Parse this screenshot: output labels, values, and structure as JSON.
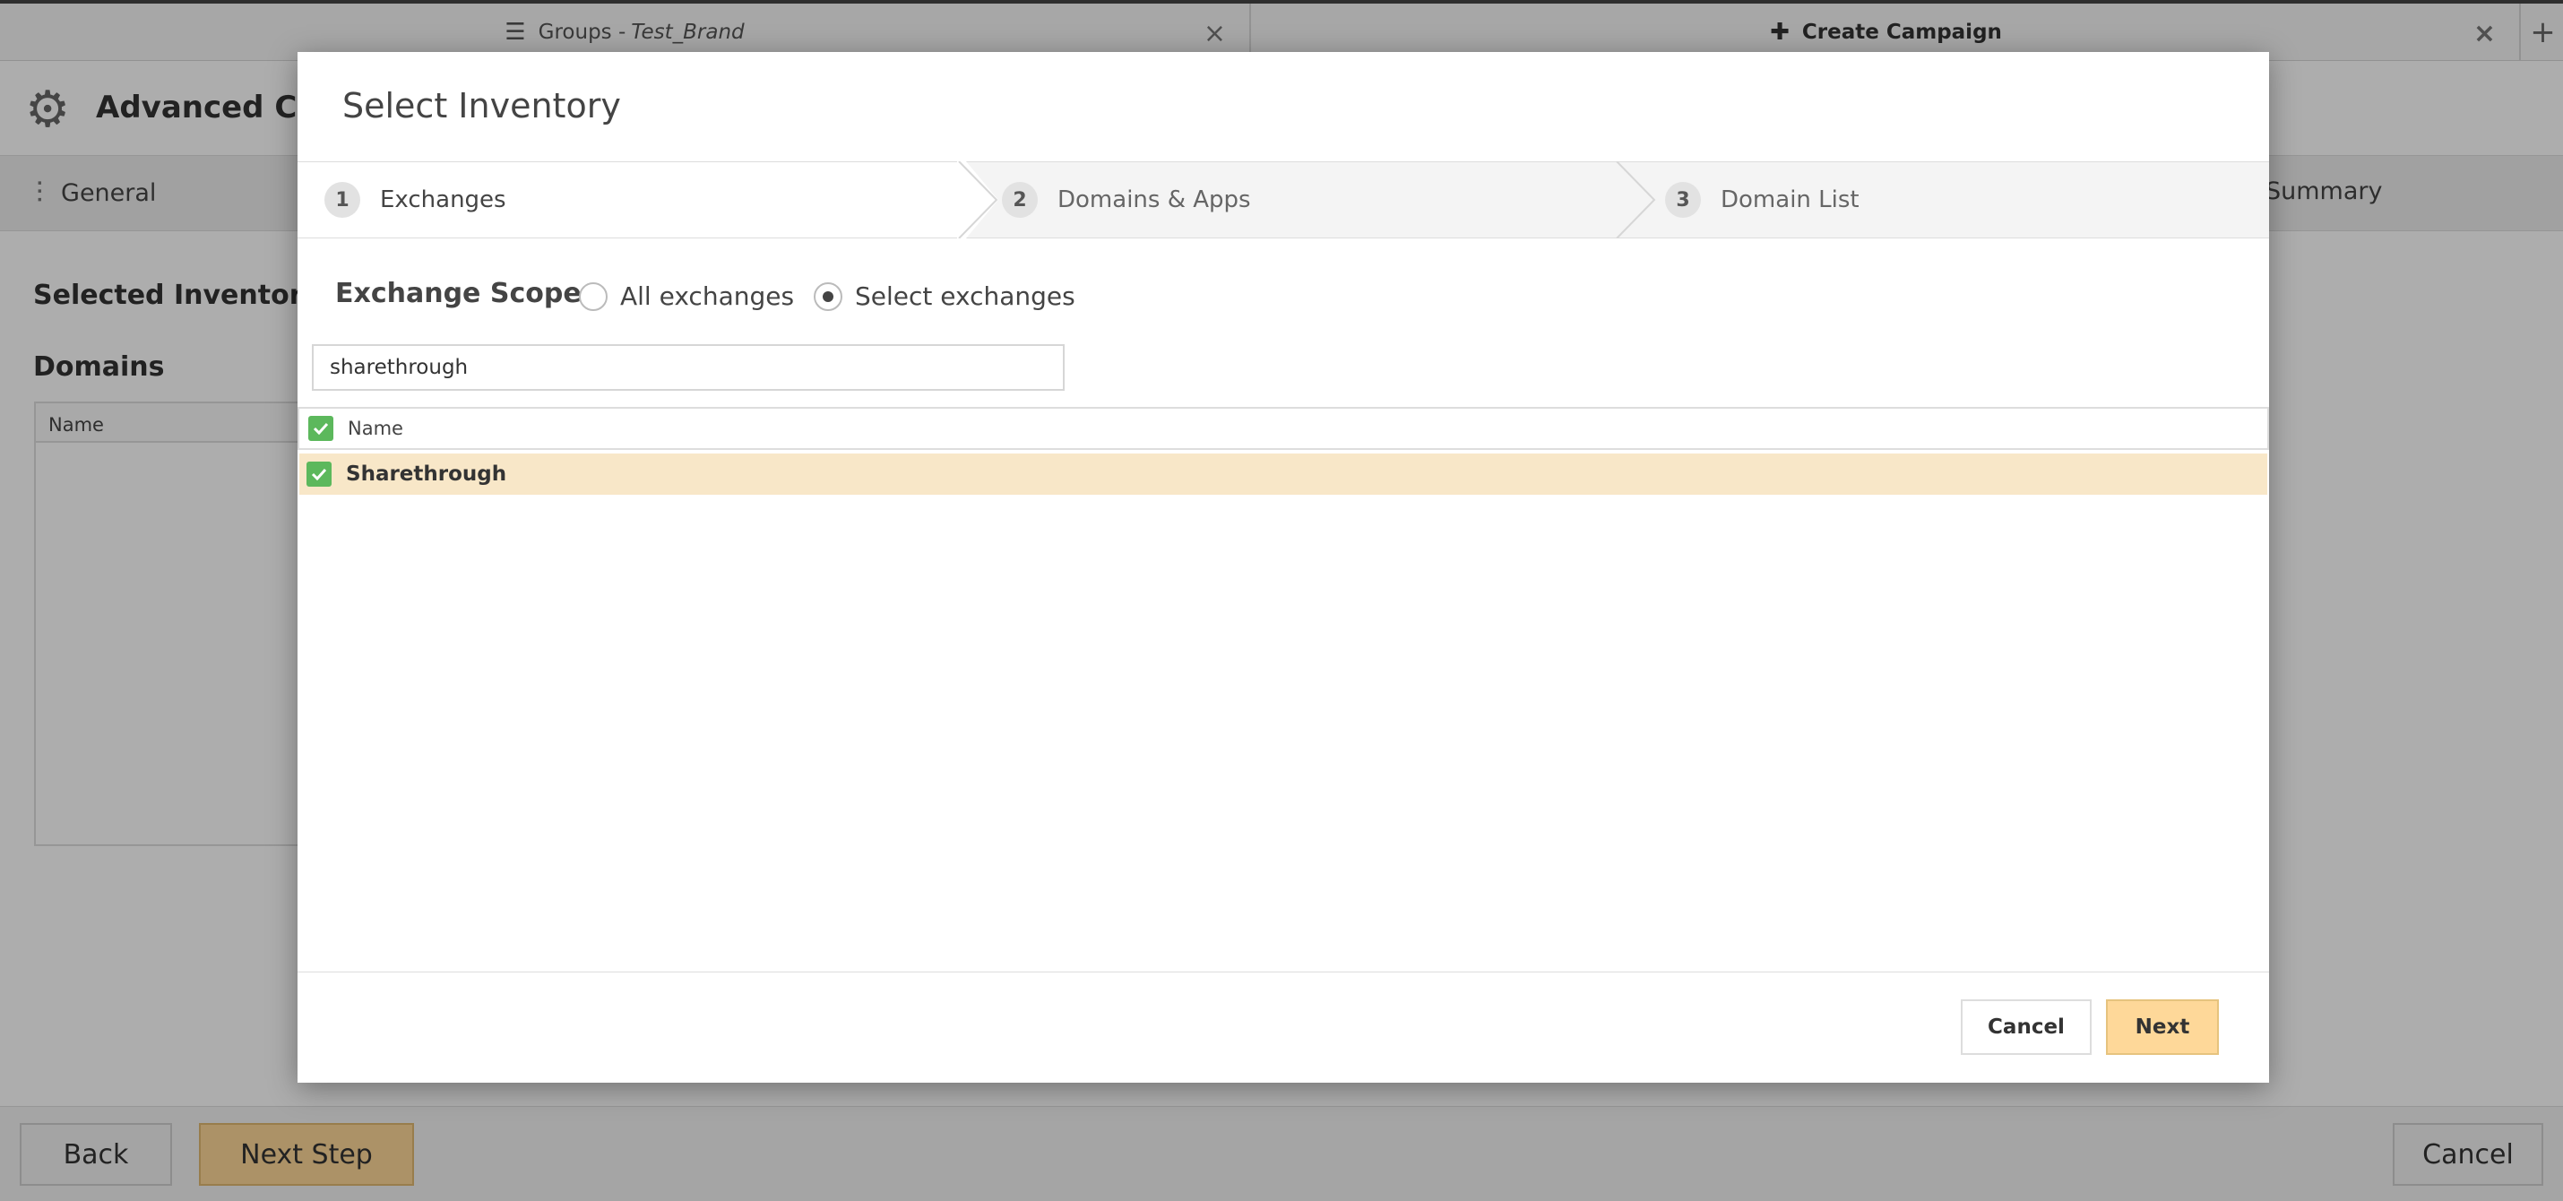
{
  "tabs": [
    {
      "icon": "menu-icon",
      "label_prefix": "Groups - ",
      "label_italic": "Test_Brand"
    },
    {
      "icon": "plus-icon",
      "label": "Create Campaign"
    }
  ],
  "page": {
    "title": "Advanced Cam",
    "steps": {
      "general": "General",
      "summary": "Summary"
    },
    "selected_inventory": "Selected Inventory",
    "domains_heading": "Domains",
    "domains_table_header": "Name"
  },
  "footer": {
    "back": "Back",
    "next_step": "Next Step",
    "cancel": "Cancel"
  },
  "modal": {
    "title": "Select Inventory",
    "wizard": [
      {
        "num": "1",
        "label": "Exchanges",
        "active": true
      },
      {
        "num": "2",
        "label": "Domains & Apps",
        "active": false
      },
      {
        "num": "3",
        "label": "Domain List",
        "active": false
      }
    ],
    "scope_label": "Exchange Scope",
    "scope_options": [
      {
        "label": "All exchanges",
        "selected": false
      },
      {
        "label": "Select exchanges",
        "selected": true
      }
    ],
    "search_value": "sharethrough",
    "grid_header": "Name",
    "rows": [
      {
        "name": "Sharethrough",
        "checked": true
      }
    ],
    "cancel": "Cancel",
    "next": "Next"
  },
  "colors": {
    "accent": "#fed899",
    "check": "#5cb85c",
    "row_selected": "#f8e7c8"
  }
}
